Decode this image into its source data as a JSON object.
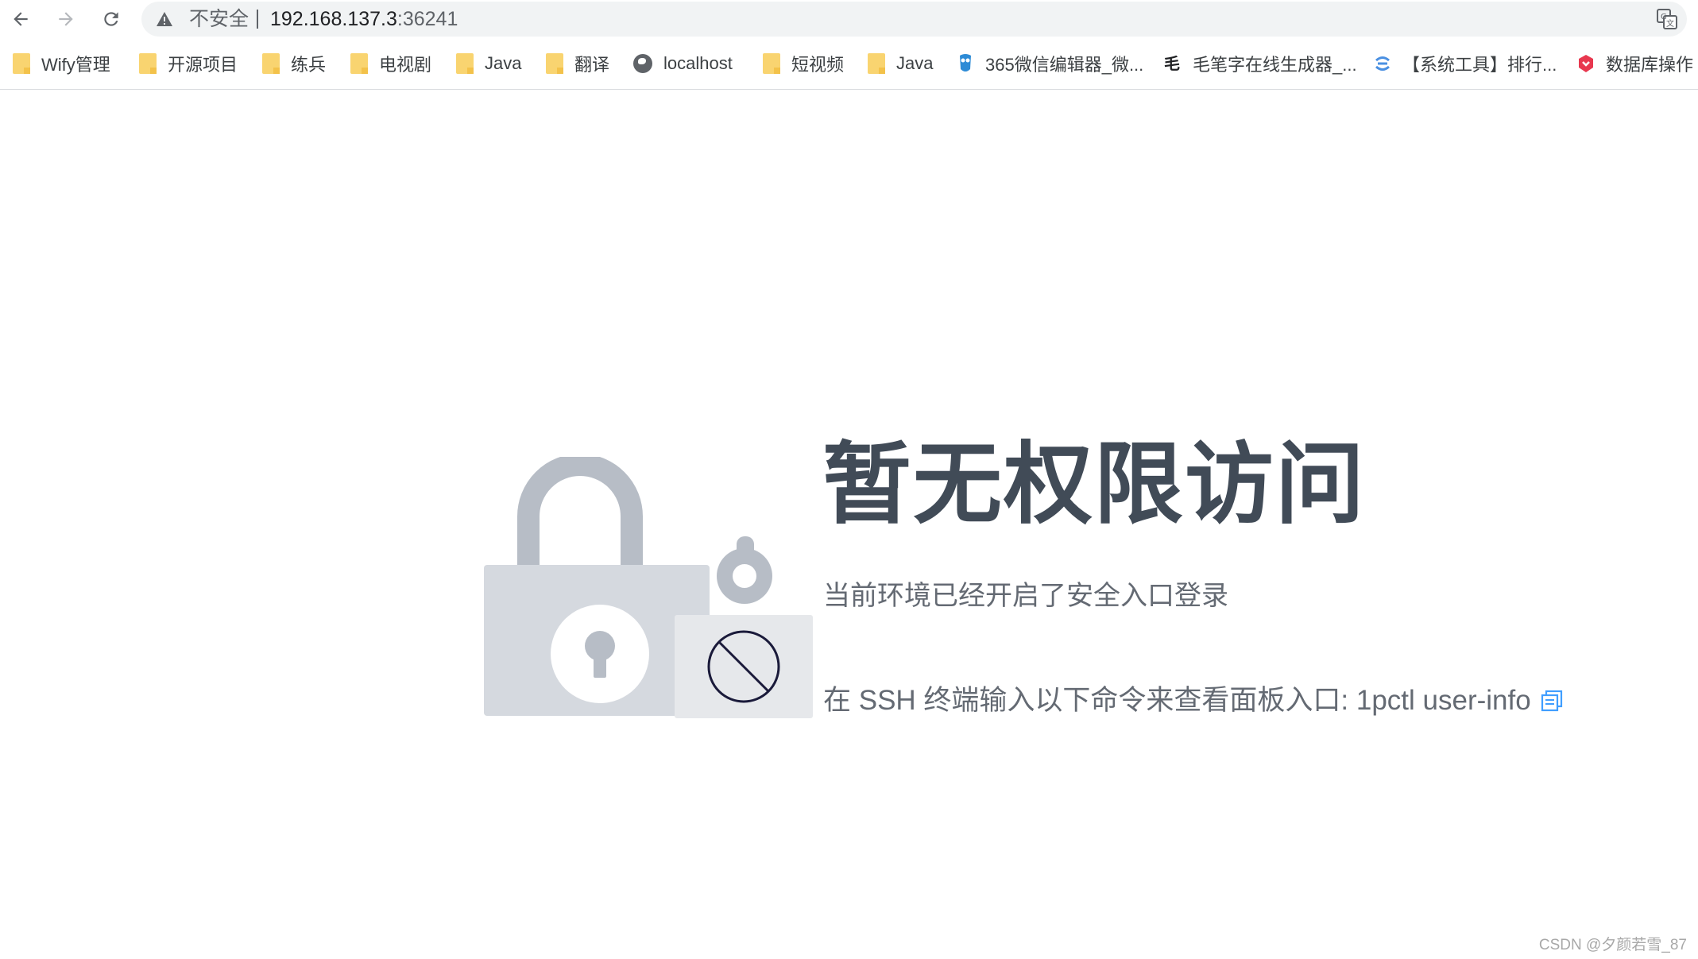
{
  "browser": {
    "security_label": "不安全",
    "url_host": "192.168.137.3",
    "url_port": ":36241"
  },
  "bookmarks": [
    {
      "label": "Wify管理",
      "icon": "folder-icon"
    },
    {
      "label": "开源项目",
      "icon": "folder-icon"
    },
    {
      "label": "练兵",
      "icon": "folder-icon"
    },
    {
      "label": "电视剧",
      "icon": "folder-icon"
    },
    {
      "label": "Java",
      "icon": "folder-icon"
    },
    {
      "label": "翻译",
      "icon": "folder-icon"
    },
    {
      "label": "localhost",
      "icon": "globe-icon"
    },
    {
      "label": "短视频",
      "icon": "folder-icon"
    },
    {
      "label": "Java",
      "icon": "folder-icon"
    },
    {
      "label": "365微信编辑器_微...",
      "icon": "owl-icon"
    },
    {
      "label": "毛笔字在线生成器_...",
      "icon": "brush-icon"
    },
    {
      "label": "【系统工具】排行...",
      "icon": "tool-icon"
    },
    {
      "label": "数据库操作",
      "icon": "db-icon"
    }
  ],
  "page": {
    "title": "暂无权限访问",
    "subtitle": "当前环境已经开启了安全入口登录",
    "hint_text": "在 SSH 终端输入以下命令来查看面板入口: 1pctl user-info"
  },
  "watermark": "CSDN @夕颜若雪_87",
  "colors": {
    "title": "#414b57",
    "text": "#646a73",
    "accent": "#409eff",
    "lock_body": "#d5d9df",
    "lock_shackle": "#b7bdc6"
  }
}
